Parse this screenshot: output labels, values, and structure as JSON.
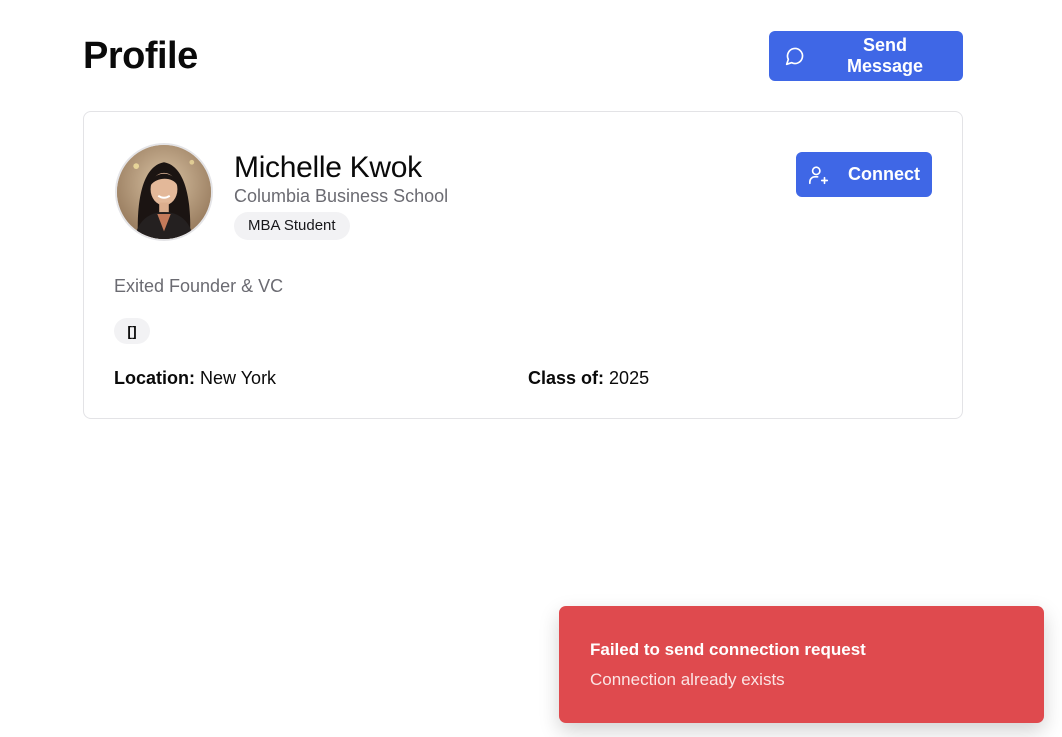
{
  "header": {
    "title": "Profile",
    "send_message_label": "Send Message",
    "send_message_icon": "message-circle-icon",
    "accent_color": "#3f67e6"
  },
  "profile": {
    "name": "Michelle Kwok",
    "school": "Columbia Business School",
    "role_badge": "MBA Student",
    "bio": "Exited Founder & VC",
    "tags_text": "[]",
    "connect_label": "Connect",
    "connect_icon": "user-plus-icon",
    "location_label": "Location:",
    "location_value": "New York",
    "class_label": "Class of:",
    "class_value": "2025"
  },
  "toast": {
    "title": "Failed to send connection request",
    "description": "Connection already exists",
    "color": "#df4a4e"
  }
}
